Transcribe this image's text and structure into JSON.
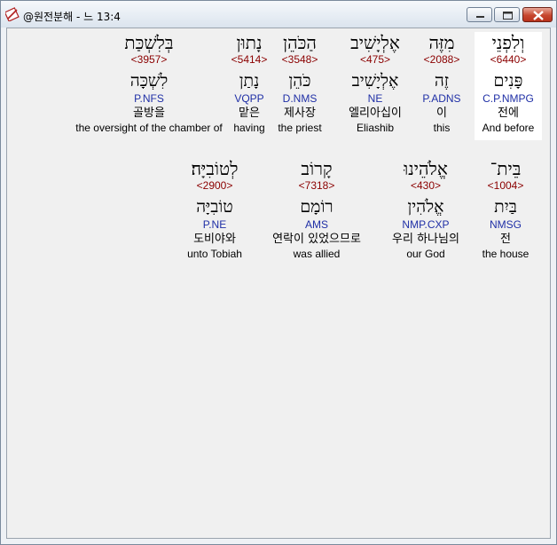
{
  "window": {
    "title": "@원전분해 - 느 13:4"
  },
  "rows": [
    {
      "words": [
        {
          "heb": "וְלִפְנֵי",
          "strong": "<6440>",
          "lemma": "פָּנִים",
          "morph": "C.P.NMPG",
          "kor": "전에",
          "eng": "And before",
          "selected": true
        },
        {
          "heb": "מִזֶּה",
          "strong": "<2088>",
          "lemma": "זֶה",
          "morph": "P.ADNS",
          "kor": "이",
          "eng": "this"
        },
        {
          "heb": "אֶלְיָשִׁיב",
          "strong": "<475>",
          "lemma": "אֶלְיָשִׁיב",
          "morph": "NE",
          "kor": "엘리아십이",
          "eng": "Eliashib"
        },
        {
          "heb": "הַכֹּהֵן",
          "strong": "<3548>",
          "lemma": "כֹּהֵן",
          "morph": "D.NMS",
          "kor": "제사장",
          "eng": "the priest"
        },
        {
          "heb": "נָתוּן",
          "strong": "<5414>",
          "lemma": "נָתַן",
          "morph": "VQPP",
          "kor": "맡은",
          "eng": "having"
        },
        {
          "heb": "בְּלִשְׁכַּת",
          "strong": "<3957>",
          "lemma": "לִשְׁכָּה",
          "morph": "P.NFS",
          "kor": "골방을",
          "eng": "the oversight of the chamber of"
        }
      ]
    },
    {
      "words": [
        {
          "heb": "בֵּית־",
          "strong": "<1004>",
          "lemma": "בַּיִת",
          "morph": "NMSG",
          "kor": "전",
          "eng": "the house"
        },
        {
          "heb": "אֱלֹהֵינוּ",
          "strong": "<430>",
          "lemma": "אֱלֹהִין",
          "morph": "NMP.CXP",
          "kor": "우리 하나님의",
          "eng": "our God"
        },
        {
          "heb": "קָרוֹב",
          "strong": "<7318>",
          "lemma": "רוֹמָם",
          "morph": "AMS",
          "kor": "연락이 있었으므로",
          "eng": "was allied"
        },
        {
          "heb": "לְטוֹבִיָּה׃",
          "strong": "<2900>",
          "lemma": "טוֹבִיָּה",
          "morph": "P.NE",
          "kor": "도비야와",
          "eng": "unto Tobiah"
        }
      ]
    }
  ],
  "colors": {
    "strong": "#8b0000",
    "morph": "#1f2fa6",
    "selected_bg": "#ffffff",
    "close_button": "#c7472f"
  },
  "icons": {
    "app": "bible-app-icon",
    "minimize": "minimize-icon",
    "maximize": "maximize-icon",
    "close": "close-icon"
  }
}
